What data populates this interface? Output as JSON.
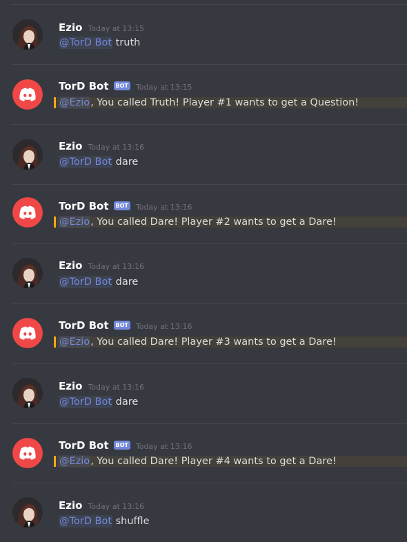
{
  "messages": [
    {
      "author": "Ezio",
      "is_bot": false,
      "timestamp": "Today at 13:15",
      "mention": "@TorD Bot",
      "text": " truth"
    },
    {
      "author": "TorD Bot",
      "is_bot": true,
      "bot_tag": "BOT",
      "timestamp": "Today at 13:15",
      "mention": "@Ezio",
      "text": ", You called Truth! Player #1 wants to get a Question!"
    },
    {
      "author": "Ezio",
      "is_bot": false,
      "timestamp": "Today at 13:16",
      "mention": "@TorD Bot",
      "text": " dare"
    },
    {
      "author": "TorD Bot",
      "is_bot": true,
      "bot_tag": "BOT",
      "timestamp": "Today at 13:16",
      "mention": "@Ezio",
      "text": ", You called Dare! Player #2 wants to get a Dare!"
    },
    {
      "author": "Ezio",
      "is_bot": false,
      "timestamp": "Today at 13:16",
      "mention": "@TorD Bot",
      "text": " dare"
    },
    {
      "author": "TorD Bot",
      "is_bot": true,
      "bot_tag": "BOT",
      "timestamp": "Today at 13:16",
      "mention": "@Ezio",
      "text": ", You called Dare! Player #3 wants to get a Dare!"
    },
    {
      "author": "Ezio",
      "is_bot": false,
      "timestamp": "Today at 13:16",
      "mention": "@TorD Bot",
      "text": " dare"
    },
    {
      "author": "TorD Bot",
      "is_bot": true,
      "bot_tag": "BOT",
      "timestamp": "Today at 13:16",
      "mention": "@Ezio",
      "text": ", You called Dare! Player #4 wants to get a Dare!"
    },
    {
      "author": "Ezio",
      "is_bot": false,
      "timestamp": "Today at 13:16",
      "mention": "@TorD Bot",
      "text": " shuffle"
    }
  ],
  "colors": {
    "background": "#36393f",
    "bot_avatar": "#f04747",
    "bot_tag": "#7289da",
    "mention": "#7289da",
    "highlight_accent": "#faa61a"
  },
  "icons": {
    "user_avatar": "anime-avatar-icon",
    "bot_avatar": "discord-logo-icon"
  }
}
